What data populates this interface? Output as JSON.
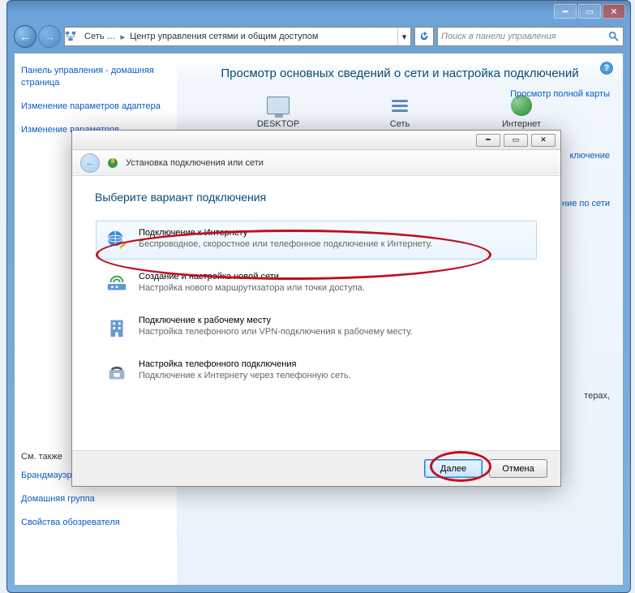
{
  "window": {
    "breadcrumb": {
      "root": "Сеть …",
      "current": "Центр управления сетями и общим доступом"
    },
    "search_placeholder": "Поиск в панели управления"
  },
  "sidebar": {
    "items": [
      "Панель управления - домашняя страница",
      "Изменение параметров адаптера",
      "Изменение параметров"
    ],
    "see_also_label": "См. также",
    "see_also": [
      "Брандмауэр Windows",
      "Домашняя группа",
      "Свойства обозревателя"
    ]
  },
  "main": {
    "title": "Просмотр основных сведений о сети и настройка подключений",
    "full_map_link": "Просмотр полной карты",
    "nodes": {
      "desktop": "DESKTOP",
      "network": "Сеть",
      "internet": "Интернет"
    },
    "link1": "ключение",
    "link2": "ние по сети",
    "link3": "терах,"
  },
  "dialog": {
    "header": "Установка подключения или сети",
    "subtitle": "Выберите вариант подключения",
    "options": [
      {
        "title": "Подключение к Интернету",
        "desc": "Беспроводное, скоростное или телефонное подключение к Интернету."
      },
      {
        "title": "Создание и настройка новой сети",
        "desc": "Настройка нового маршрутизатора или точки доступа."
      },
      {
        "title": "Подключение к рабочему месту",
        "desc": "Настройка телефонного или VPN-подключения к рабочему месту."
      },
      {
        "title": "Настройка телефонного подключения",
        "desc": "Подключение к Интернету через телефонную сеть."
      }
    ],
    "next_label": "Далее",
    "cancel_label": "Отмена"
  }
}
